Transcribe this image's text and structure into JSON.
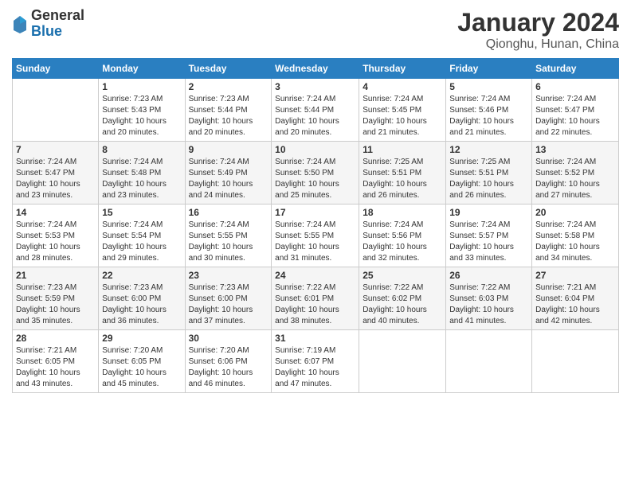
{
  "header": {
    "logo_general": "General",
    "logo_blue": "Blue",
    "main_title": "January 2024",
    "subtitle": "Qionghu, Hunan, China"
  },
  "weekdays": [
    "Sunday",
    "Monday",
    "Tuesday",
    "Wednesday",
    "Thursday",
    "Friday",
    "Saturday"
  ],
  "weeks": [
    [
      {
        "day": "",
        "sunrise": "",
        "sunset": "",
        "daylight": ""
      },
      {
        "day": "1",
        "sunrise": "Sunrise: 7:23 AM",
        "sunset": "Sunset: 5:43 PM",
        "daylight": "Daylight: 10 hours and 20 minutes."
      },
      {
        "day": "2",
        "sunrise": "Sunrise: 7:23 AM",
        "sunset": "Sunset: 5:44 PM",
        "daylight": "Daylight: 10 hours and 20 minutes."
      },
      {
        "day": "3",
        "sunrise": "Sunrise: 7:24 AM",
        "sunset": "Sunset: 5:44 PM",
        "daylight": "Daylight: 10 hours and 20 minutes."
      },
      {
        "day": "4",
        "sunrise": "Sunrise: 7:24 AM",
        "sunset": "Sunset: 5:45 PM",
        "daylight": "Daylight: 10 hours and 21 minutes."
      },
      {
        "day": "5",
        "sunrise": "Sunrise: 7:24 AM",
        "sunset": "Sunset: 5:46 PM",
        "daylight": "Daylight: 10 hours and 21 minutes."
      },
      {
        "day": "6",
        "sunrise": "Sunrise: 7:24 AM",
        "sunset": "Sunset: 5:47 PM",
        "daylight": "Daylight: 10 hours and 22 minutes."
      }
    ],
    [
      {
        "day": "7",
        "sunrise": "Sunrise: 7:24 AM",
        "sunset": "Sunset: 5:47 PM",
        "daylight": "Daylight: 10 hours and 23 minutes."
      },
      {
        "day": "8",
        "sunrise": "Sunrise: 7:24 AM",
        "sunset": "Sunset: 5:48 PM",
        "daylight": "Daylight: 10 hours and 23 minutes."
      },
      {
        "day": "9",
        "sunrise": "Sunrise: 7:24 AM",
        "sunset": "Sunset: 5:49 PM",
        "daylight": "Daylight: 10 hours and 24 minutes."
      },
      {
        "day": "10",
        "sunrise": "Sunrise: 7:24 AM",
        "sunset": "Sunset: 5:50 PM",
        "daylight": "Daylight: 10 hours and 25 minutes."
      },
      {
        "day": "11",
        "sunrise": "Sunrise: 7:25 AM",
        "sunset": "Sunset: 5:51 PM",
        "daylight": "Daylight: 10 hours and 26 minutes."
      },
      {
        "day": "12",
        "sunrise": "Sunrise: 7:25 AM",
        "sunset": "Sunset: 5:51 PM",
        "daylight": "Daylight: 10 hours and 26 minutes."
      },
      {
        "day": "13",
        "sunrise": "Sunrise: 7:24 AM",
        "sunset": "Sunset: 5:52 PM",
        "daylight": "Daylight: 10 hours and 27 minutes."
      }
    ],
    [
      {
        "day": "14",
        "sunrise": "Sunrise: 7:24 AM",
        "sunset": "Sunset: 5:53 PM",
        "daylight": "Daylight: 10 hours and 28 minutes."
      },
      {
        "day": "15",
        "sunrise": "Sunrise: 7:24 AM",
        "sunset": "Sunset: 5:54 PM",
        "daylight": "Daylight: 10 hours and 29 minutes."
      },
      {
        "day": "16",
        "sunrise": "Sunrise: 7:24 AM",
        "sunset": "Sunset: 5:55 PM",
        "daylight": "Daylight: 10 hours and 30 minutes."
      },
      {
        "day": "17",
        "sunrise": "Sunrise: 7:24 AM",
        "sunset": "Sunset: 5:55 PM",
        "daylight": "Daylight: 10 hours and 31 minutes."
      },
      {
        "day": "18",
        "sunrise": "Sunrise: 7:24 AM",
        "sunset": "Sunset: 5:56 PM",
        "daylight": "Daylight: 10 hours and 32 minutes."
      },
      {
        "day": "19",
        "sunrise": "Sunrise: 7:24 AM",
        "sunset": "Sunset: 5:57 PM",
        "daylight": "Daylight: 10 hours and 33 minutes."
      },
      {
        "day": "20",
        "sunrise": "Sunrise: 7:24 AM",
        "sunset": "Sunset: 5:58 PM",
        "daylight": "Daylight: 10 hours and 34 minutes."
      }
    ],
    [
      {
        "day": "21",
        "sunrise": "Sunrise: 7:23 AM",
        "sunset": "Sunset: 5:59 PM",
        "daylight": "Daylight: 10 hours and 35 minutes."
      },
      {
        "day": "22",
        "sunrise": "Sunrise: 7:23 AM",
        "sunset": "Sunset: 6:00 PM",
        "daylight": "Daylight: 10 hours and 36 minutes."
      },
      {
        "day": "23",
        "sunrise": "Sunrise: 7:23 AM",
        "sunset": "Sunset: 6:00 PM",
        "daylight": "Daylight: 10 hours and 37 minutes."
      },
      {
        "day": "24",
        "sunrise": "Sunrise: 7:22 AM",
        "sunset": "Sunset: 6:01 PM",
        "daylight": "Daylight: 10 hours and 38 minutes."
      },
      {
        "day": "25",
        "sunrise": "Sunrise: 7:22 AM",
        "sunset": "Sunset: 6:02 PM",
        "daylight": "Daylight: 10 hours and 40 minutes."
      },
      {
        "day": "26",
        "sunrise": "Sunrise: 7:22 AM",
        "sunset": "Sunset: 6:03 PM",
        "daylight": "Daylight: 10 hours and 41 minutes."
      },
      {
        "day": "27",
        "sunrise": "Sunrise: 7:21 AM",
        "sunset": "Sunset: 6:04 PM",
        "daylight": "Daylight: 10 hours and 42 minutes."
      }
    ],
    [
      {
        "day": "28",
        "sunrise": "Sunrise: 7:21 AM",
        "sunset": "Sunset: 6:05 PM",
        "daylight": "Daylight: 10 hours and 43 minutes."
      },
      {
        "day": "29",
        "sunrise": "Sunrise: 7:20 AM",
        "sunset": "Sunset: 6:05 PM",
        "daylight": "Daylight: 10 hours and 45 minutes."
      },
      {
        "day": "30",
        "sunrise": "Sunrise: 7:20 AM",
        "sunset": "Sunset: 6:06 PM",
        "daylight": "Daylight: 10 hours and 46 minutes."
      },
      {
        "day": "31",
        "sunrise": "Sunrise: 7:19 AM",
        "sunset": "Sunset: 6:07 PM",
        "daylight": "Daylight: 10 hours and 47 minutes."
      },
      {
        "day": "",
        "sunrise": "",
        "sunset": "",
        "daylight": ""
      },
      {
        "day": "",
        "sunrise": "",
        "sunset": "",
        "daylight": ""
      },
      {
        "day": "",
        "sunrise": "",
        "sunset": "",
        "daylight": ""
      }
    ]
  ]
}
